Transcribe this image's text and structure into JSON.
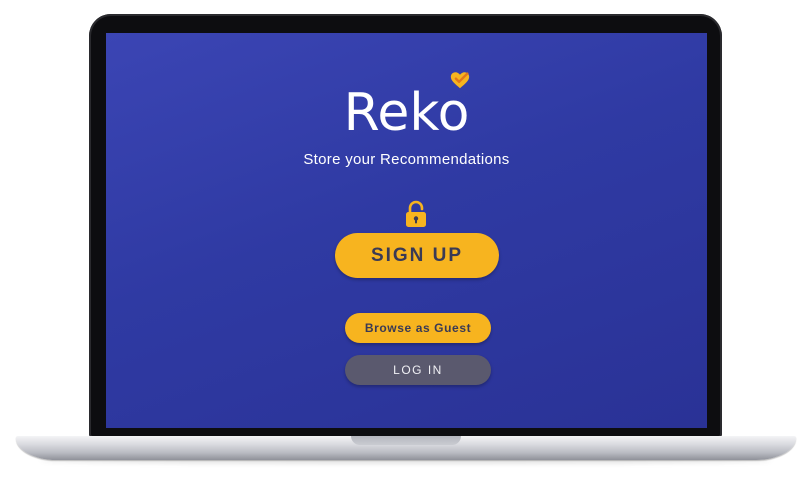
{
  "app": {
    "logo_text": "Reko",
    "tagline": "Store your Recommendations"
  },
  "buttons": {
    "signup_label": "SIGN UP",
    "guest_label": "Browse as Guest",
    "login_label": "LOG IN"
  },
  "icons": {
    "logo_accent": "heart-check-icon",
    "signup_hint": "unlocked-padlock-icon"
  },
  "colors": {
    "screen_background": "#3040a8",
    "accent": "#f7b41f",
    "login_button": "#5a596e",
    "button_text": "#3a3a55"
  }
}
